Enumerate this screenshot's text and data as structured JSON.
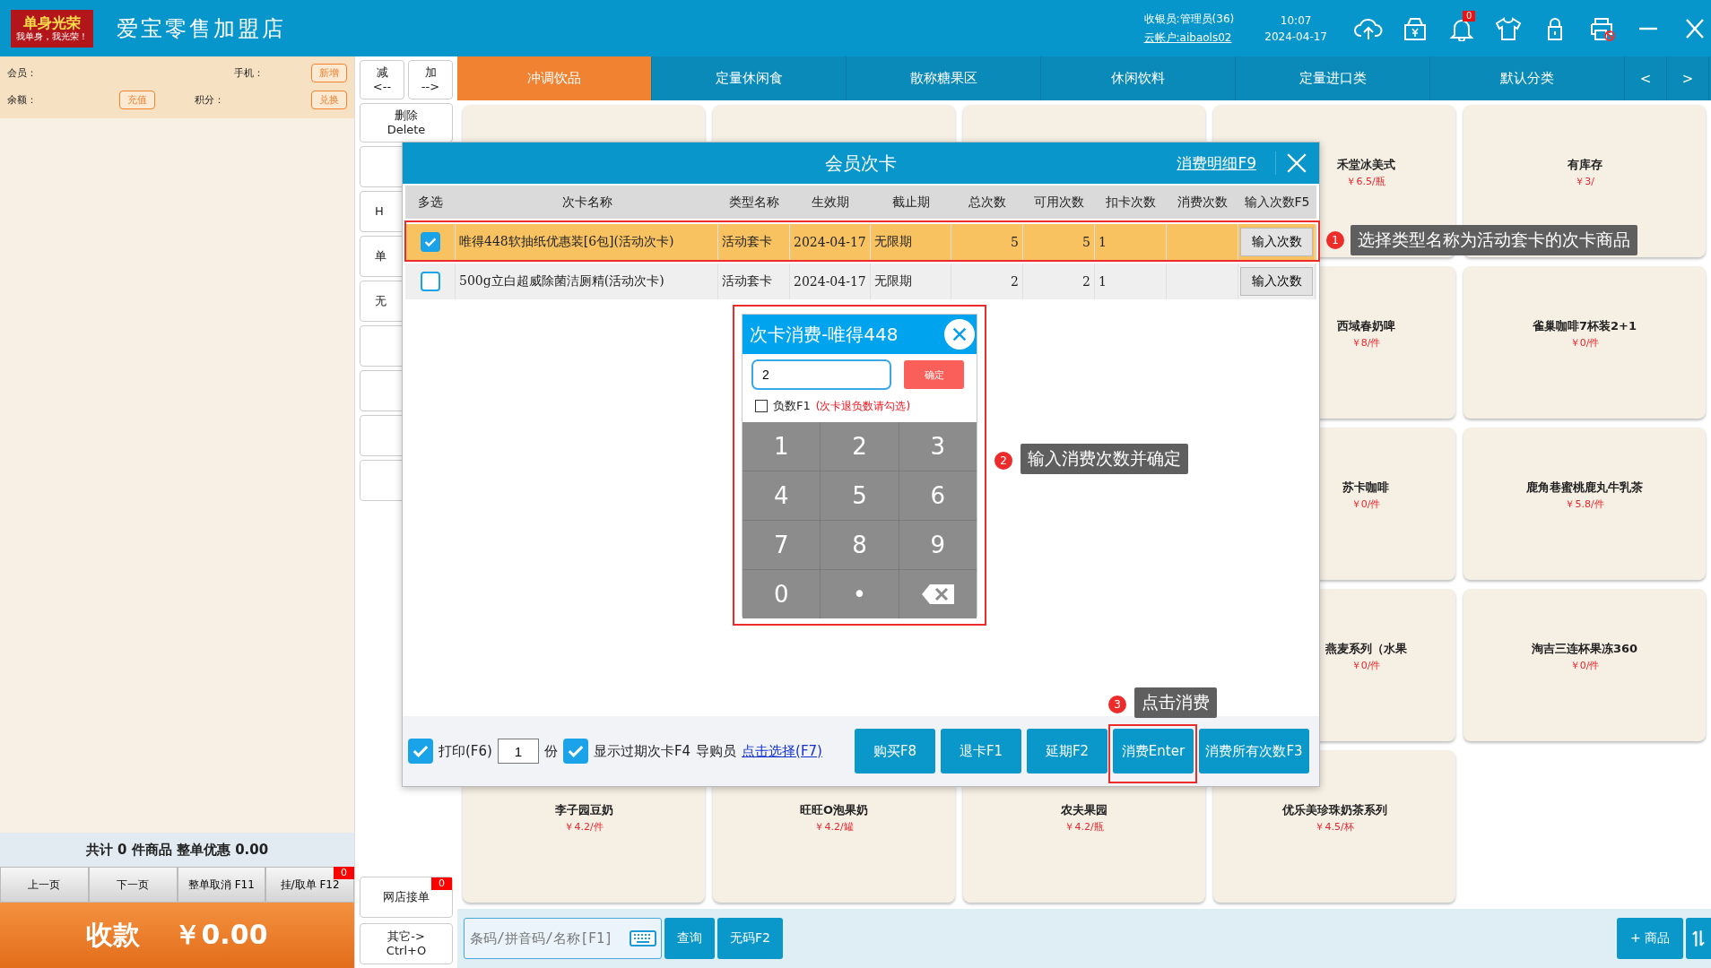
{
  "top_bar": {
    "logo": {
      "title": "单身光荣",
      "slogan": "我单身，我光荣！"
    },
    "store_name": "爱宝零售加盟店",
    "cashier": "收银员:管理员(36)",
    "cloud_account": "云帐户:aibaols02",
    "time": "10:07",
    "date": "2024-04-17",
    "notification_count": "0"
  },
  "member_panel": {
    "member_label": "会员：",
    "phone_label": "手机：",
    "add_button": "新增",
    "balance_label": "余额：",
    "recharge_button": "充值",
    "points_label": "积分：",
    "redeem_button": "兑换"
  },
  "order_summary": "共计 0 件商品 整单优惠 0.00",
  "order_buttons": [
    {
      "label": "上一页"
    },
    {
      "label": "下一页"
    },
    {
      "label": "整单取消 F11"
    },
    {
      "label": "挂/取单 F12",
      "badge": "0"
    }
  ],
  "checkout": {
    "label": "收款",
    "amount": "￥0.00"
  },
  "side_buttons": [
    {
      "kind": "half",
      "label": "减",
      "hint": "<--"
    },
    {
      "kind": "half",
      "label": "加",
      "hint": "-->"
    },
    {
      "kind": "full",
      "label": "删除",
      "hint": "Delete"
    }
  ],
  "covered_buttons": [
    {
      "kind": "blank"
    },
    {
      "kind": "text",
      "label": "H"
    },
    {
      "kind": "text",
      "label": "单"
    },
    {
      "kind": "text",
      "label": "无"
    },
    {
      "kind": "blank"
    },
    {
      "kind": "blank"
    },
    {
      "kind": "blank"
    },
    {
      "kind": "blank"
    }
  ],
  "side_bottom_buttons": [
    {
      "label": "网店接单",
      "badge": "0"
    },
    {
      "label": "其它->",
      "hint": "Ctrl+O"
    }
  ],
  "category_tabs": [
    {
      "label": "冲调饮品",
      "selected": true
    },
    {
      "label": "定量休闲食",
      "selected": false
    },
    {
      "label": "散称糖果区",
      "selected": false
    },
    {
      "label": "休闲饮料",
      "selected": false
    },
    {
      "label": "定量进口类",
      "selected": false
    },
    {
      "label": "默认分类",
      "selected": false
    }
  ],
  "tab_nav": [
    "<",
    ">"
  ],
  "product_grid": {
    "rows": [
      [
        {},
        {},
        {},
        {
          "name": "禾堂冰美式",
          "price": "￥6.5/瓶"
        },
        {
          "name": "有库存",
          "price": "￥3/"
        }
      ],
      [
        {},
        {},
        {},
        {
          "name": "西域春奶啤",
          "price": "￥8/件"
        },
        {
          "name": "雀巢咖啡7杯装2+1",
          "price": "￥0/件"
        }
      ],
      [
        {},
        {},
        {},
        {
          "name": "苏卡咖啡",
          "price": "￥0/件"
        },
        {
          "name": "鹿角巷蜜桃鹿丸牛乳茶",
          "price": "￥5.8/件"
        }
      ],
      [
        {},
        {},
        {},
        {
          "name": "燕麦系列（水果",
          "price": "￥0/件"
        },
        {
          "name": "淘吉三连杯果冻360",
          "price": "￥0/件"
        }
      ],
      [
        {
          "name": "李子园豆奶",
          "price": "￥4.2/件"
        },
        {
          "name": "旺旺O泡果奶",
          "price": "￥4.2/罐"
        },
        {
          "name": "农夫果园",
          "price": "￥4.2/瓶"
        },
        {
          "name": "优乐美珍珠奶茶系列",
          "price": "￥4.5/杯"
        }
      ]
    ]
  },
  "bottom_bar": {
    "search": {
      "placeholder": "条码/拼音码/名称[F1]"
    },
    "query_button": "查询",
    "no_code_button": "无码F2",
    "add_product_button": "+ 商品"
  },
  "card_dialog": {
    "title": "会员次卡",
    "details_link": "消费明细F9",
    "columns": [
      "多选",
      "次卡名称",
      "类型名称",
      "生效期",
      "截止期",
      "总次数",
      "可用次数",
      "扣卡次数",
      "消费次数",
      "输入次数F5"
    ],
    "rows": [
      {
        "checked": true,
        "selected": true,
        "name": "唯得448软抽纸优惠装[6包](活动次卡)",
        "type": "活动套卡",
        "start": "2024-04-17",
        "end": "无限期",
        "total": "5",
        "available": "5",
        "deduct": "1",
        "button": "输入次数"
      },
      {
        "checked": false,
        "selected": false,
        "name": "500g立白超威除菌洁厕精(活动次卡)",
        "type": "活动套卡",
        "start": "2024-04-17",
        "end": "无限期",
        "total": "2",
        "available": "2",
        "deduct": "1",
        "button": "输入次数"
      }
    ],
    "footer": {
      "print": {
        "label": "打印(F6)",
        "checked": true
      },
      "copies": "1",
      "copies_unit": "份",
      "show_expired": {
        "label": "显示过期次卡F4",
        "checked": true
      },
      "guide_label": "导购员",
      "guide_link": "点击选择(F7)",
      "buttons": [
        "购买F8",
        "退卡F1",
        "延期F2",
        "消费Enter",
        "消费所有次数F3"
      ]
    }
  },
  "consume_dialog": {
    "title": "次卡消费-唯得448",
    "value": "2",
    "confirm_button": "确定",
    "negative": {
      "label": "负数F1",
      "checked": false
    },
    "note": "(次卡退负数请勾选)",
    "keys": [
      {
        "kind": "digit",
        "label": "1"
      },
      {
        "kind": "digit",
        "label": "2"
      },
      {
        "kind": "digit",
        "label": "3"
      },
      {
        "kind": "digit",
        "label": "4"
      },
      {
        "kind": "digit",
        "label": "5"
      },
      {
        "kind": "digit",
        "label": "6"
      },
      {
        "kind": "digit",
        "label": "7"
      },
      {
        "kind": "digit",
        "label": "8"
      },
      {
        "kind": "digit",
        "label": "9"
      },
      {
        "kind": "digit",
        "label": "0"
      },
      {
        "kind": "digit",
        "label": "•"
      },
      {
        "kind": "backspace"
      }
    ]
  },
  "annotations": [
    {
      "number": "1",
      "text": "选择类型名称为活动套卡的次卡商品"
    },
    {
      "number": "2",
      "text": "输入消费次数并确定"
    },
    {
      "number": "3",
      "text": "点击消费"
    }
  ]
}
